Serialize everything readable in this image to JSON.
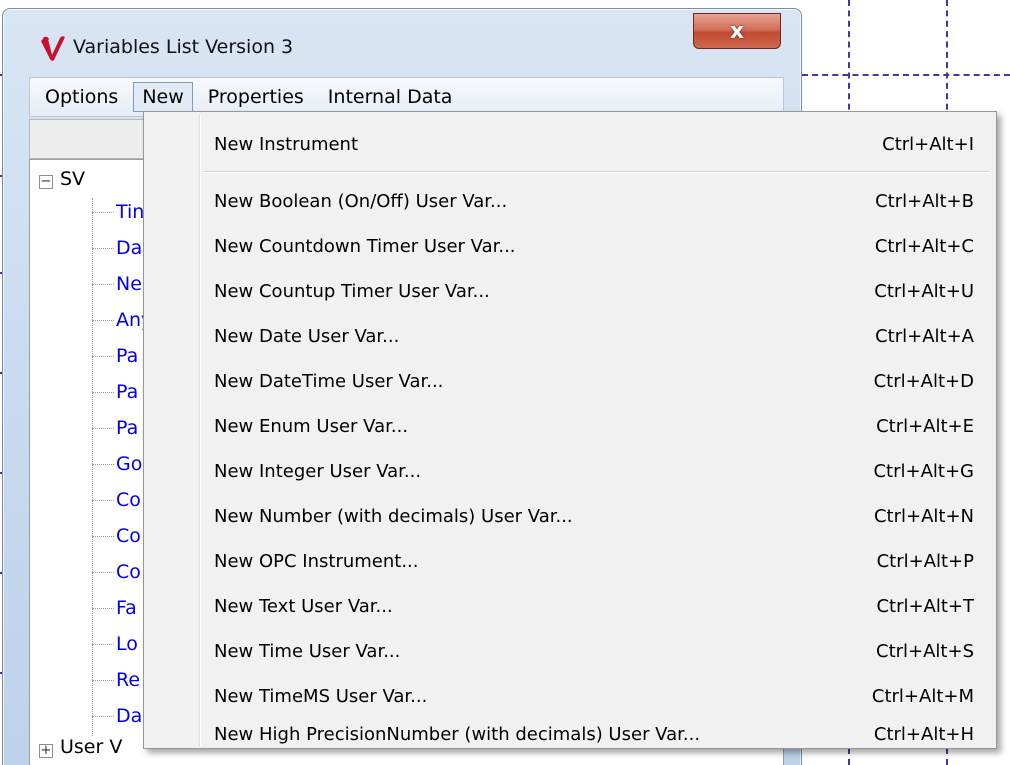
{
  "window": {
    "title": "Variables List Version 3",
    "close_glyph": "x",
    "logo_icon": "v-logo-icon"
  },
  "menubar": {
    "items": [
      "Options",
      "New",
      "Properties",
      "Internal Data"
    ],
    "active": "New"
  },
  "tree": {
    "root": {
      "label": "SV",
      "expander": "−"
    },
    "children": [
      "Tin",
      "Da",
      "Ne",
      "Any",
      "Pa",
      "Pa",
      "Pa",
      "Go",
      "Co",
      "Co",
      "Co",
      "Fa",
      "Lo",
      "Re",
      "Da"
    ],
    "second_root": {
      "label": "User V",
      "expander": "+"
    }
  },
  "dropdown": {
    "items": [
      {
        "label": "New Instrument",
        "shortcut": "Ctrl+Alt+I"
      },
      {
        "label": "New Boolean (On/Off) User Var...",
        "shortcut": "Ctrl+Alt+B"
      },
      {
        "label": "New Countdown Timer User Var...",
        "shortcut": "Ctrl+Alt+C"
      },
      {
        "label": "New Countup Timer User Var...",
        "shortcut": "Ctrl+Alt+U"
      },
      {
        "label": "New Date User Var...",
        "shortcut": "Ctrl+Alt+A"
      },
      {
        "label": "New DateTime User Var...",
        "shortcut": "Ctrl+Alt+D"
      },
      {
        "label": "New Enum User Var...",
        "shortcut": "Ctrl+Alt+E"
      },
      {
        "label": "New Integer User Var...",
        "shortcut": "Ctrl+Alt+G"
      },
      {
        "label": "New Number (with decimals) User Var...",
        "shortcut": "Ctrl+Alt+N"
      },
      {
        "label": "New OPC Instrument...",
        "shortcut": "Ctrl+Alt+P"
      },
      {
        "label": "New Text User Var...",
        "shortcut": "Ctrl+Alt+T"
      },
      {
        "label": "New Time User Var...",
        "shortcut": "Ctrl+Alt+S"
      },
      {
        "label": "New TimeMS User Var...",
        "shortcut": "Ctrl+Alt+M"
      },
      {
        "label": "New High PrecisionNumber (with decimals) User Var...",
        "shortcut": "Ctrl+Alt+H"
      }
    ]
  },
  "colors": {
    "link_blue": "#0000ee",
    "canvas_guide": "#3a3aa8",
    "close_red": "#c04a32"
  }
}
